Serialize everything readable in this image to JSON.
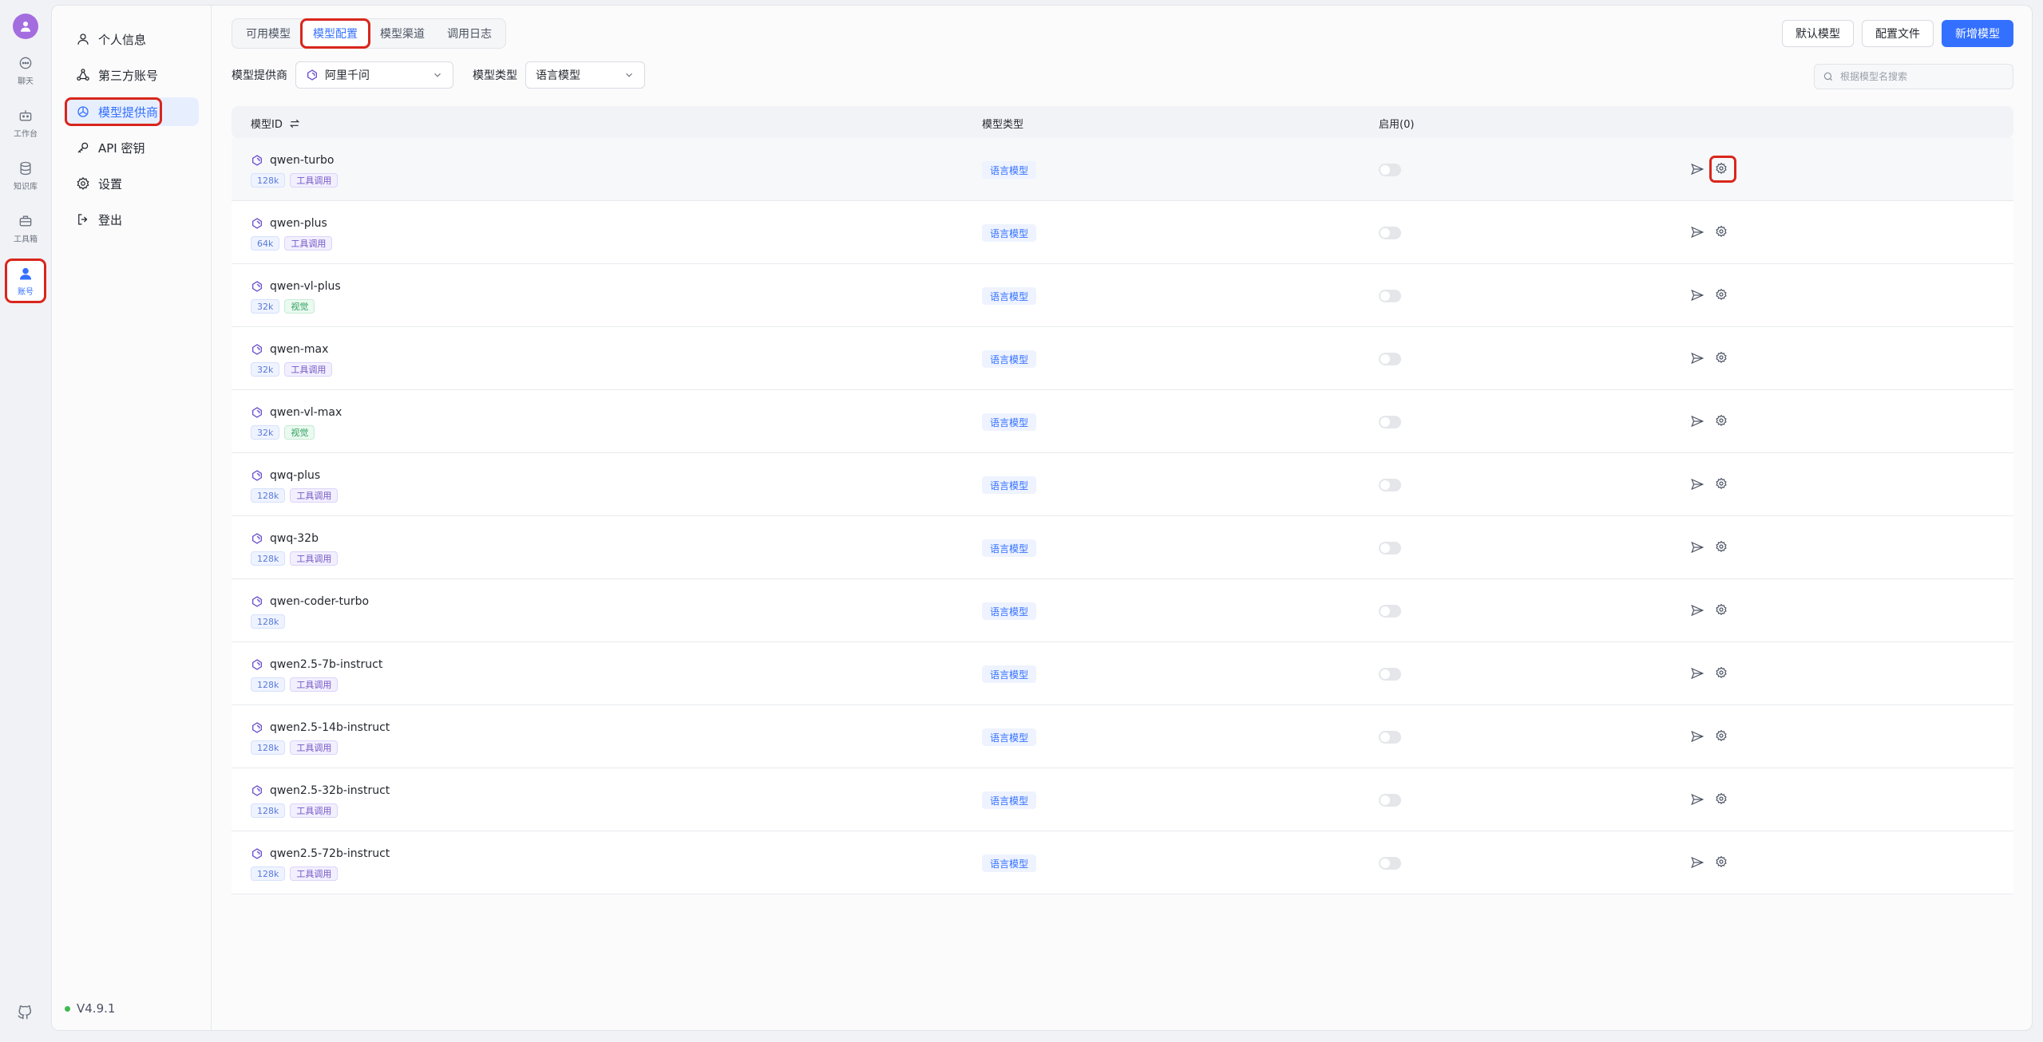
{
  "rail": {
    "items": [
      {
        "label": "聊天",
        "icon": "chat-icon"
      },
      {
        "label": "工作台",
        "icon": "robot-icon"
      },
      {
        "label": "知识库",
        "icon": "database-icon"
      },
      {
        "label": "工具箱",
        "icon": "toolbox-icon"
      },
      {
        "label": "账号",
        "icon": "user-icon",
        "active": true
      }
    ]
  },
  "subnav": {
    "items": [
      {
        "label": "个人信息",
        "icon": "user-outline-icon"
      },
      {
        "label": "第三方账号",
        "icon": "link-icon"
      },
      {
        "label": "模型提供商",
        "icon": "model-provider-icon",
        "active": true
      },
      {
        "label": "API 密钥",
        "icon": "key-icon"
      },
      {
        "label": "设置",
        "icon": "gear-icon"
      },
      {
        "label": "登出",
        "icon": "logout-icon"
      }
    ],
    "version": "V4.9.1"
  },
  "tabs": [
    {
      "label": "可用模型"
    },
    {
      "label": "模型配置",
      "active": true
    },
    {
      "label": "模型渠道"
    },
    {
      "label": "调用日志"
    }
  ],
  "actions": {
    "default_model": "默认模型",
    "config_file": "配置文件",
    "add_model": "新增模型"
  },
  "filters": {
    "provider_label": "模型提供商",
    "provider_value": "阿里千问",
    "type_label": "模型类型",
    "type_value": "语言模型",
    "search_placeholder": "根据模型名搜索"
  },
  "table": {
    "headers": {
      "id": "模型ID",
      "type": "模型类型",
      "enable": "启用(0)"
    },
    "rows": [
      {
        "name": "qwen-turbo",
        "tags": [
          [
            "128k",
            "ctx"
          ],
          [
            "工具调用",
            "tool"
          ]
        ],
        "type": "语言模型"
      },
      {
        "name": "qwen-plus",
        "tags": [
          [
            "64k",
            "ctx"
          ],
          [
            "工具调用",
            "tool"
          ]
        ],
        "type": "语言模型"
      },
      {
        "name": "qwen-vl-plus",
        "tags": [
          [
            "32k",
            "ctx"
          ],
          [
            "视觉",
            "vision"
          ]
        ],
        "type": "语言模型"
      },
      {
        "name": "qwen-max",
        "tags": [
          [
            "32k",
            "ctx"
          ],
          [
            "工具调用",
            "tool"
          ]
        ],
        "type": "语言模型"
      },
      {
        "name": "qwen-vl-max",
        "tags": [
          [
            "32k",
            "ctx"
          ],
          [
            "视觉",
            "vision"
          ]
        ],
        "type": "语言模型"
      },
      {
        "name": "qwq-plus",
        "tags": [
          [
            "128k",
            "ctx"
          ],
          [
            "工具调用",
            "tool"
          ]
        ],
        "type": "语言模型"
      },
      {
        "name": "qwq-32b",
        "tags": [
          [
            "128k",
            "ctx"
          ],
          [
            "工具调用",
            "tool"
          ]
        ],
        "type": "语言模型"
      },
      {
        "name": "qwen-coder-turbo",
        "tags": [
          [
            "128k",
            "ctx"
          ]
        ],
        "type": "语言模型"
      },
      {
        "name": "qwen2.5-7b-instruct",
        "tags": [
          [
            "128k",
            "ctx"
          ],
          [
            "工具调用",
            "tool"
          ]
        ],
        "type": "语言模型"
      },
      {
        "name": "qwen2.5-14b-instruct",
        "tags": [
          [
            "128k",
            "ctx"
          ],
          [
            "工具调用",
            "tool"
          ]
        ],
        "type": "语言模型"
      },
      {
        "name": "qwen2.5-32b-instruct",
        "tags": [
          [
            "128k",
            "ctx"
          ],
          [
            "工具调用",
            "tool"
          ]
        ],
        "type": "语言模型"
      },
      {
        "name": "qwen2.5-72b-instruct",
        "tags": [
          [
            "128k",
            "ctx"
          ],
          [
            "工具调用",
            "tool"
          ]
        ],
        "type": "语言模型"
      }
    ]
  },
  "colors": {
    "accent": "#3370ff",
    "highlight": "#d9261c"
  }
}
